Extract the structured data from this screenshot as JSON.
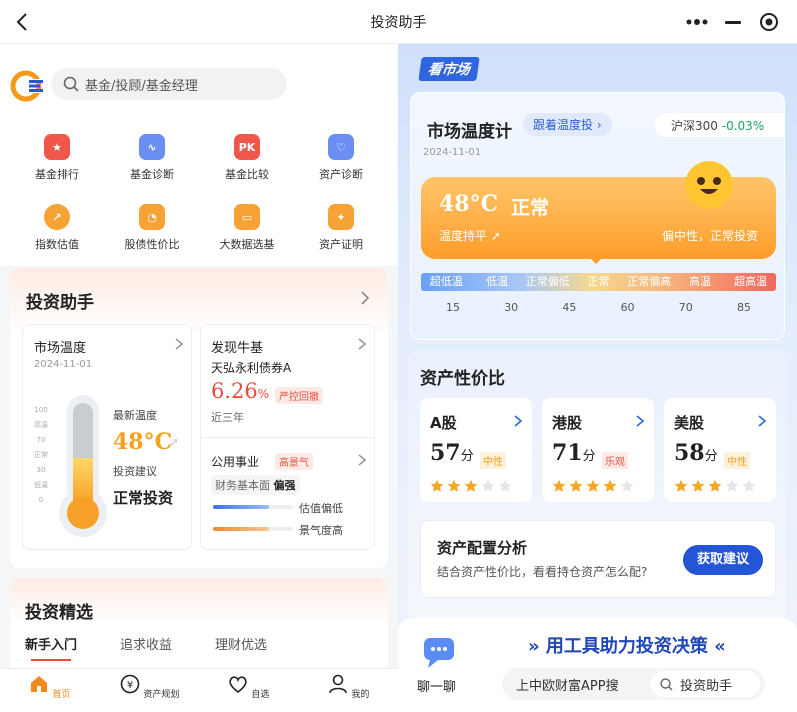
{
  "topbar": {
    "title": "投资助手"
  },
  "search": {
    "placeholder": "基金/投顾/基金经理"
  },
  "tools": [
    {
      "label": "基金排行",
      "icon": "trophy-icon",
      "color": "#f0574a"
    },
    {
      "label": "基金诊断",
      "icon": "pulse-icon",
      "color": "#6b8ef2"
    },
    {
      "label": "基金比较",
      "icon": "pk-icon",
      "color": "#f0574a"
    },
    {
      "label": "资产诊断",
      "icon": "stethoscope-icon",
      "color": "#6b8ef2"
    },
    {
      "label": "指数估值",
      "icon": "chart-icon",
      "color": "#f7a234"
    },
    {
      "label": "股债性价比",
      "icon": "gauge-icon",
      "color": "#f7a234"
    },
    {
      "label": "大数据选基",
      "icon": "monitor-icon",
      "color": "#f7a234"
    },
    {
      "label": "资产证明",
      "icon": "certificate-icon",
      "color": "#f7a234"
    }
  ],
  "assistant": {
    "title": "投资助手",
    "market_temp": {
      "title": "市场温度",
      "date": "2024-11-01",
      "latest_label": "最新温度",
      "value": "48°C",
      "advice_label": "投资建议",
      "advice": "正常投资",
      "scale": [
        "100",
        "高温",
        "70",
        "正常",
        "30",
        "低温",
        "0"
      ],
      "level": 0.48
    },
    "bull_fund": {
      "title": "发现牛基",
      "name": "天弘永利债券A",
      "rate": "6.26",
      "rate_unit": "%",
      "tag": "严控回撤",
      "period": "近三年"
    },
    "utility": {
      "title": "公用事业",
      "tag": "高景气",
      "fund_label": "财务基本面",
      "fund_value": "偏强",
      "bar1_label": "估值偏低",
      "bar2_label": "景气度高",
      "bar1_level": 0.7,
      "bar2_level": 0.7
    }
  },
  "picks": {
    "title": "投资精选",
    "tabs": [
      "新手入门",
      "追求收益",
      "理财优选"
    ]
  },
  "bottom_nav": [
    {
      "label": "首页",
      "icon": "home-icon",
      "active": true
    },
    {
      "label": "资产规划",
      "icon": "yuan-icon",
      "active": false
    },
    {
      "label": "自选",
      "icon": "heart-icon",
      "active": false
    },
    {
      "label": "我的",
      "icon": "user-icon",
      "active": false
    }
  ],
  "market": {
    "badge": "看市场",
    "thermometer": {
      "title": "市场温度计",
      "follow": "跟着温度投",
      "index_name": "沪深300",
      "index_change": "-0.03%",
      "date": "2024-11-01",
      "temp": "48°C",
      "status": "正常",
      "trend": "温度持平",
      "advice": "偏中性，正常投资",
      "zones": [
        "超低温",
        "低温",
        "正常偏低",
        "正常",
        "正常偏高",
        "高温",
        "超高温"
      ],
      "ticks": [
        "15",
        "30",
        "45",
        "60",
        "70",
        "85"
      ],
      "pointer_zone": 3
    },
    "value_ratio": {
      "title": "资产性价比",
      "items": [
        {
          "name": "A股",
          "score": "57",
          "unit": "分",
          "tag": "中性",
          "tag_color": "#f2a11e",
          "stars": 3
        },
        {
          "name": "港股",
          "score": "71",
          "unit": "分",
          "tag": "乐观",
          "tag_color": "#e5533c",
          "stars": 4
        },
        {
          "name": "美股",
          "score": "58",
          "unit": "分",
          "tag": "中性",
          "tag_color": "#f2a11e",
          "stars": 3
        }
      ]
    },
    "allocation": {
      "title": "资产配置分析",
      "desc": "结合资产性价比，看看持仓资产怎么配?",
      "button": "获取建议"
    },
    "promo": {
      "chat": "聊一聊",
      "slogan": "用工具助力投资决策",
      "search_prefix": "上中欧财富APP搜",
      "search_term": "投资助手"
    }
  }
}
